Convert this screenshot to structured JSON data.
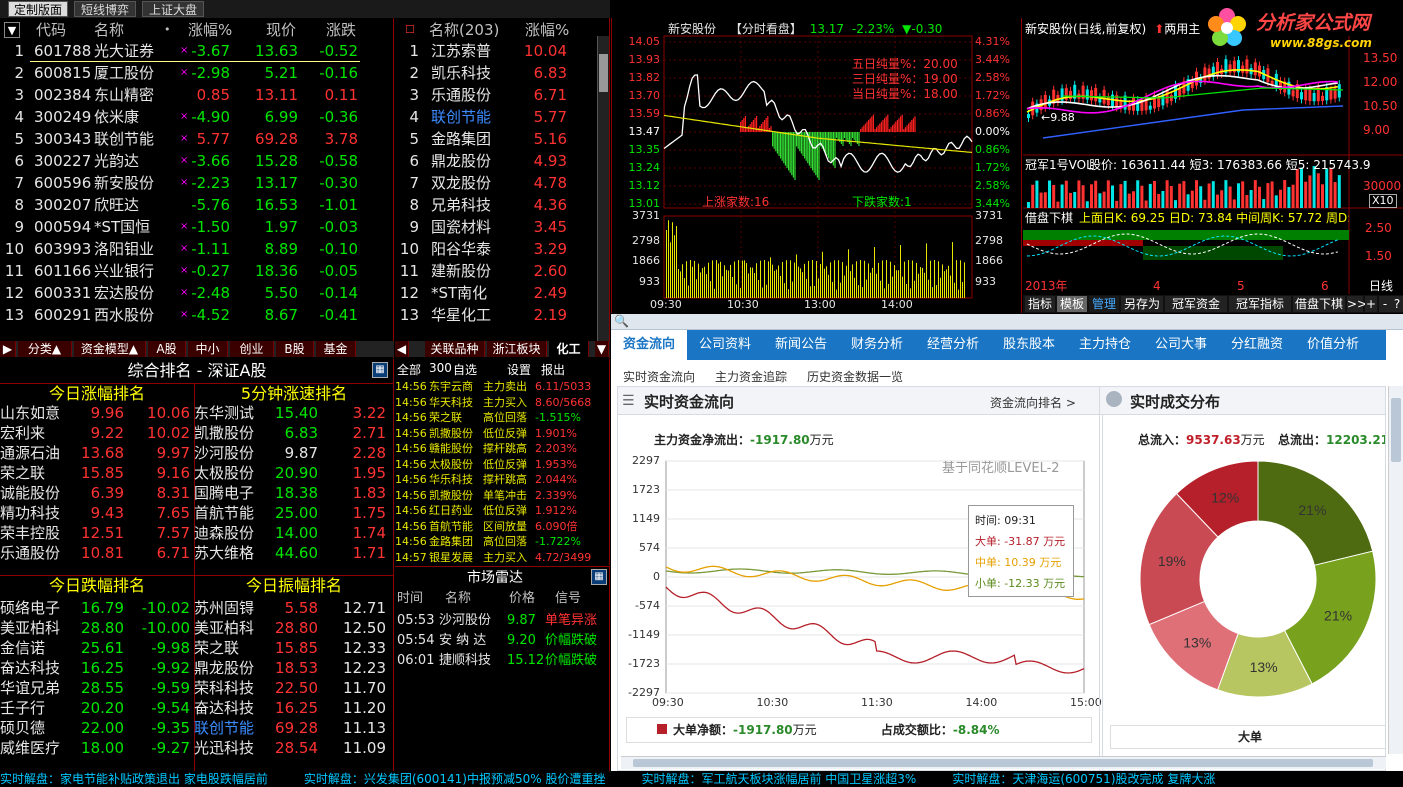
{
  "top_tabs": [
    "定制版面",
    "短线博弈",
    "上证大盘"
  ],
  "quote": {
    "headers": [
      "代码",
      "名称",
      "涨幅%",
      "现价",
      "涨跌"
    ],
    "rows": [
      {
        "n": "1",
        "code": "601788",
        "name": "光大证券",
        "pct": "-3.67",
        "price": "13.63",
        "chg": "-0.52"
      },
      {
        "n": "2",
        "code": "600815",
        "name": "厦工股份",
        "pct": "-2.98",
        "price": "5.21",
        "chg": "-0.16"
      },
      {
        "n": "3",
        "code": "002384",
        "name": "东山精密",
        "pct": "0.85",
        "price": "13.11",
        "chg": "0.11"
      },
      {
        "n": "4",
        "code": "300249",
        "name": "依米康",
        "pct": "-4.90",
        "price": "6.99",
        "chg": "-0.36"
      },
      {
        "n": "5",
        "code": "300343",
        "name": "联创节能",
        "pct": "5.77",
        "price": "69.28",
        "chg": "3.78"
      },
      {
        "n": "6",
        "code": "300227",
        "name": "光韵达",
        "pct": "-3.66",
        "price": "15.28",
        "chg": "-0.58"
      },
      {
        "n": "7",
        "code": "600596",
        "name": "新安股份",
        "pct": "-2.23",
        "price": "13.17",
        "chg": "-0.30"
      },
      {
        "n": "8",
        "code": "300207",
        "name": "欣旺达",
        "pct": "-5.76",
        "price": "16.53",
        "chg": "-1.01"
      },
      {
        "n": "9",
        "code": "000594",
        "name": "*ST国恒",
        "pct": "-1.50",
        "price": "1.97",
        "chg": "-0.03"
      },
      {
        "n": "10",
        "code": "603993",
        "name": "洛阳钼业",
        "pct": "-1.11",
        "price": "8.89",
        "chg": "-0.10"
      },
      {
        "n": "11",
        "code": "601166",
        "name": "兴业银行",
        "pct": "-0.27",
        "price": "18.36",
        "chg": "-0.05"
      },
      {
        "n": "12",
        "code": "600331",
        "name": "宏达股份",
        "pct": "-2.48",
        "price": "5.50",
        "chg": "-0.14"
      },
      {
        "n": "13",
        "code": "600291",
        "name": "西水股份",
        "pct": "-4.52",
        "price": "8.67",
        "chg": "-0.41"
      }
    ],
    "bottom_tabs": [
      "分类▲",
      "资金模型▲",
      "A股",
      "中小",
      "创业",
      "B股",
      "基金"
    ]
  },
  "sector": {
    "name_header": "名称(203)",
    "pct_header": "涨幅%",
    "rows": [
      {
        "n": "1",
        "name": "江苏索普",
        "pct": "10.04"
      },
      {
        "n": "2",
        "name": "凯乐科技",
        "pct": "6.83"
      },
      {
        "n": "3",
        "name": "乐通股份",
        "pct": "6.71"
      },
      {
        "n": "4",
        "name": "联创节能",
        "pct": "5.77"
      },
      {
        "n": "5",
        "name": "金路集团",
        "pct": "5.16"
      },
      {
        "n": "6",
        "name": "鼎龙股份",
        "pct": "4.93"
      },
      {
        "n": "7",
        "name": "双龙股份",
        "pct": "4.78"
      },
      {
        "n": "8",
        "name": "兄弟科技",
        "pct": "4.36"
      },
      {
        "n": "9",
        "name": "国瓷材料",
        "pct": "3.45"
      },
      {
        "n": "10",
        "name": "阳谷华泰",
        "pct": "3.29"
      },
      {
        "n": "11",
        "name": "建新股份",
        "pct": "2.60"
      },
      {
        "n": "12",
        "name": "*ST南化",
        "pct": "2.49"
      },
      {
        "n": "13",
        "name": "华星化工",
        "pct": "2.19"
      }
    ],
    "bottom_tabs": [
      "关联品种",
      "浙江板块",
      "化工"
    ]
  },
  "rank": {
    "title": "综合排名 - 深证A股",
    "up_title": "今日涨幅排名",
    "speed_title": "5分钟涨速排名",
    "down_title": "今日跌幅排名",
    "amp_title": "今日振幅排名",
    "up": [
      [
        "山东如意",
        "9.96",
        "10.06"
      ],
      [
        "宏利来",
        "9.22",
        "10.02"
      ],
      [
        "通源石油",
        "13.68",
        "9.97"
      ],
      [
        "荣之联",
        "15.85",
        "9.16"
      ],
      [
        "诚能股份",
        "6.39",
        "8.31"
      ],
      [
        "精功科技",
        "9.43",
        "7.65"
      ],
      [
        "荣丰控股",
        "12.51",
        "7.57"
      ],
      [
        "乐通股份",
        "10.81",
        "6.71"
      ]
    ],
    "speed": [
      [
        "东华测试",
        "15.40",
        "3.22"
      ],
      [
        "凯撒股份",
        "6.83",
        "2.71"
      ],
      [
        "沙河股份",
        "9.87",
        "2.28"
      ],
      [
        "太极股份",
        "20.90",
        "1.95"
      ],
      [
        "国腾电子",
        "18.38",
        "1.83"
      ],
      [
        "首航节能",
        "25.00",
        "1.75"
      ],
      [
        "迪森股份",
        "14.00",
        "1.74"
      ],
      [
        "苏大维格",
        "44.60",
        "1.71"
      ]
    ],
    "down": [
      [
        "硕络电子",
        "16.79",
        "-10.02"
      ],
      [
        "美亚柏科",
        "28.80",
        "-10.00"
      ],
      [
        "金信诺",
        "25.61",
        "-9.98"
      ],
      [
        "奋达科技",
        "16.25",
        "-9.92"
      ],
      [
        "华谊兄弟",
        "28.55",
        "-9.59"
      ],
      [
        "壬子行",
        "20.20",
        "-9.54"
      ],
      [
        "硕贝德",
        "22.00",
        "-9.35"
      ],
      [
        "威维医疗",
        "18.00",
        "-9.27"
      ]
    ],
    "amp": [
      [
        "苏州固锝",
        "5.58",
        "12.71"
      ],
      [
        "美亚柏科",
        "28.80",
        "12.50"
      ],
      [
        "荣之联",
        "15.85",
        "12.33"
      ],
      [
        "鼎龙股份",
        "18.53",
        "12.23"
      ],
      [
        "荣科科技",
        "22.50",
        "11.70"
      ],
      [
        "奋达科技",
        "16.25",
        "11.20"
      ],
      [
        "联创节能",
        "69.28",
        "11.13"
      ],
      [
        "光迅科技",
        "28.54",
        "11.09"
      ]
    ]
  },
  "alerts": {
    "tabs": [
      "全部",
      "300",
      "自选",
      "设置",
      "报出"
    ],
    "rows": [
      [
        "14:56",
        "东宇云商",
        "主力卖出",
        "6.11/5033"
      ],
      [
        "14:56",
        "华天科技",
        "主力买入",
        "8.60/5668"
      ],
      [
        "14:56",
        "荣之联",
        "高位回落",
        "-1.515%"
      ],
      [
        "14:56",
        "凯撒股份",
        "低位反弹",
        "1.901%"
      ],
      [
        "14:56",
        "赣能股份",
        "撑杆跳高",
        "2.203%"
      ],
      [
        "14:56",
        "太极股份",
        "低位反弹",
        "1.953%"
      ],
      [
        "14:56",
        "华乐科技",
        "撑杆跳高",
        "2.044%"
      ],
      [
        "14:56",
        "凯撒股份",
        "单笔冲击",
        "2.339%"
      ],
      [
        "14:56",
        "红日药业",
        "低位反弹",
        "1.912%"
      ],
      [
        "14:56",
        "首航节能",
        "区间放量",
        "6.090倍"
      ],
      [
        "14:56",
        "金路集团",
        "高位回落",
        "-1.722%"
      ],
      [
        "14:57",
        "银星发展",
        "主力买入",
        "4.72/3499"
      ]
    ]
  },
  "radar": {
    "title": "市场雷达",
    "headers": [
      "时间",
      "名称",
      "价格",
      "信号"
    ],
    "rows": [
      [
        "05:53",
        "沙河股份",
        "9.87",
        "单笔异涨"
      ],
      [
        "05:54",
        "安 纳 达",
        "9.20",
        "价幅跌破"
      ],
      [
        "06:01",
        "捷顺科技",
        "15.12",
        "价幅跌破"
      ]
    ]
  },
  "intraday": {
    "stock": "新安股份",
    "mode": "【分时看盘】",
    "price": "13.17",
    "pct": "-2.23%",
    "chg": "▼-0.30",
    "prices": [
      "14.05",
      "13.93",
      "13.82",
      "13.70",
      "13.59",
      "13.47",
      "13.35",
      "13.24",
      "13.12",
      "13.01"
    ],
    "pcts": [
      "4.31%",
      "3.44%",
      "2.58%",
      "1.72%",
      "0.86%",
      "0.00%",
      "0.86%",
      "1.72%",
      "2.58%",
      "3.44%"
    ],
    "vols": [
      "3731",
      "2798",
      "1866",
      "933"
    ],
    "times": [
      "09:30",
      "10:30",
      "13:00",
      "14:00"
    ],
    "notes": [
      "五日纯量%：20.00",
      "三日纯量%：19.00",
      "当日纯量%：18.00"
    ],
    "up_count": "上涨家数:16",
    "down_count": "下跌家数:1"
  },
  "kline": {
    "title": "新安股份(日线,前复权)",
    "extra": "两用主",
    "right_prices": [
      "13.50",
      "12.00",
      "10.50",
      "9.00"
    ],
    "low_mark": "←9.88",
    "vol_title": "冠军1号VOL",
    "vol_vals": "股价: 163611.44 短3: 176383.66 短5: 215743.9",
    "vol_scale": "30000",
    "vol_unit": "X10",
    "ind_title": "借盘下棋",
    "ind_vals": "上面日K: 69.25 日D: 73.84 中间周K: 57.72 周D:",
    "ind_scale": [
      "2.50",
      "1.50"
    ],
    "year": "2013年",
    "month_marks": [
      "4",
      "5",
      "6"
    ],
    "period": "日线",
    "tabs": [
      "指标",
      "模板",
      "管理",
      "另存为",
      "冠军资金",
      "冠军指标",
      "借盘下棋",
      ">>",
      "+",
      "-",
      "?"
    ]
  },
  "logo": {
    "text": "分析家公式网",
    "url": "www.88gs.com"
  },
  "web": {
    "tabs": [
      "资金流向",
      "公司资料",
      "新闻公告",
      "财务分析",
      "经营分析",
      "股东股本",
      "主力持仓",
      "公司大事",
      "分红融资",
      "价值分析"
    ],
    "subnav": [
      "实时资金流向",
      "主力资金追踪",
      "历史资金数据一览"
    ],
    "flow_title": "实时资金流向",
    "flow_link": "资金流向排名 >",
    "net_label": "主力资金净流出：",
    "net_value": "-1917.80",
    "net_unit": "万元",
    "level": "基于同花顺LEVEL-2",
    "y_ticks": [
      "2297",
      "1723",
      "1149",
      "574",
      "0",
      "-574",
      "-1149",
      "-1723",
      "-2297"
    ],
    "x_ticks": [
      "09:30",
      "10:30",
      "11:30",
      "14:00",
      "15:00"
    ],
    "tip": {
      "time": "时间: 09:31",
      "big": "大单: -31.87 万元",
      "mid": "中单: 10.39 万元",
      "small": "小单: -12.33 万元"
    },
    "foot_label": "大单净额：",
    "foot_value": "-1917.80",
    "foot_unit": "万元",
    "ratio_label": "占成交额比：",
    "ratio_value": "-8.84%",
    "dist_title": "实时成交分布",
    "in_label": "总流入：",
    "in_value": "9537.63",
    "in_unit": "万元",
    "out_label": "总流出：",
    "out_value": "12203.21",
    "legend": "大单"
  },
  "chart_data": {
    "type": "pie",
    "title": "实时成交分布",
    "labels": [
      "21%",
      "21%",
      "13%",
      "13%",
      "19%",
      "12%"
    ],
    "values": [
      21,
      21,
      13,
      13,
      19,
      12
    ],
    "colors": [
      "#4f6b12",
      "#78a21e",
      "#b7c660",
      "#e07078",
      "#c94a52",
      "#b5202a"
    ]
  },
  "ticker": "实时解盘：家电节能补贴政策退出 家电股跌幅居前　　　实时解盘：兴发集团(600141)中报预减50% 股价遭重挫　　　实时解盘：军工航天板块涨幅居前 中国卫星涨超3%　　　实时解盘：天津海运(600751)股改完成 复牌大涨"
}
